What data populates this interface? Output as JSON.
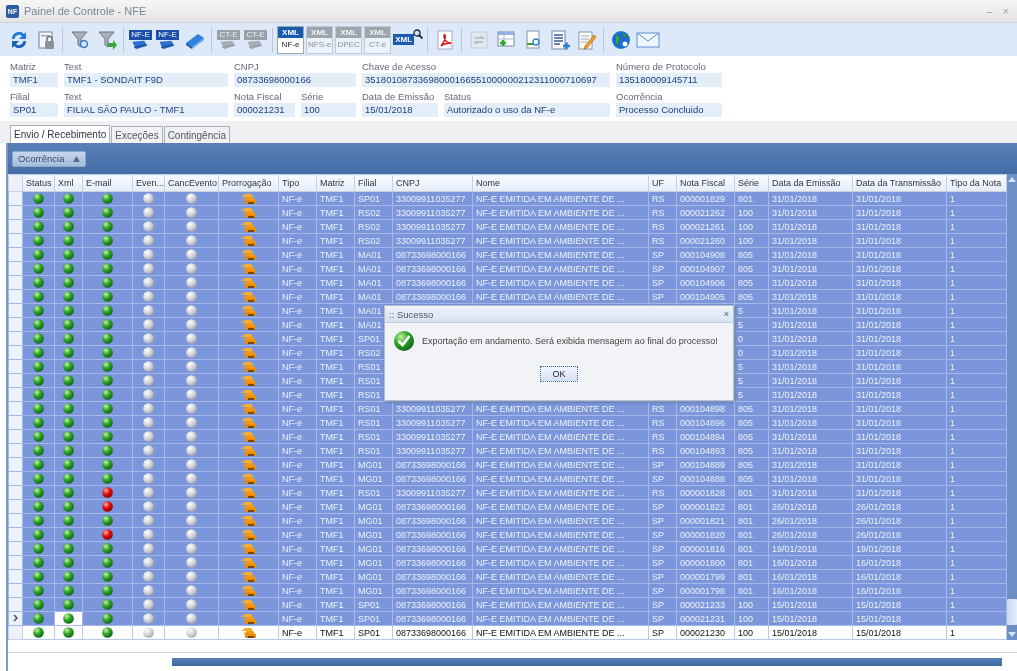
{
  "window": {
    "logo_text": "NF",
    "title": "Painel de Controle - NFE",
    "controls": [
      "–",
      "×"
    ]
  },
  "toolbar": [
    {
      "kind": "refresh",
      "disabled": false
    },
    {
      "kind": "lock-doc",
      "disabled": false
    },
    {
      "kind": "separator"
    },
    {
      "kind": "funnel-search",
      "disabled": false
    },
    {
      "kind": "funnel-arrow",
      "disabled": false
    },
    {
      "kind": "separator"
    },
    {
      "kind": "doc-badge",
      "label": "NF-E",
      "disabled": false
    },
    {
      "kind": "doc-badge",
      "label": "NF-E",
      "disabled": false
    },
    {
      "kind": "printer",
      "disabled": false
    },
    {
      "kind": "separator"
    },
    {
      "kind": "doc-badge",
      "label": "CT-E",
      "disabled": true
    },
    {
      "kind": "doc-badge",
      "label": "CT-E",
      "disabled": true
    },
    {
      "kind": "separator"
    },
    {
      "kind": "xml-tile",
      "label": "XML",
      "sublabel": "NF-e",
      "disabled": false
    },
    {
      "kind": "xml-tile",
      "label": "XML",
      "sublabel": "NFS-e",
      "disabled": true
    },
    {
      "kind": "xml-tile",
      "label": "XML",
      "sublabel": "DPEC",
      "disabled": true
    },
    {
      "kind": "xml-tile",
      "label": "XML",
      "sublabel": "CT-e",
      "disabled": true
    },
    {
      "kind": "xml-search",
      "label": "XML",
      "disabled": false
    },
    {
      "kind": "separator"
    },
    {
      "kind": "pdf",
      "disabled": false
    },
    {
      "kind": "separator"
    },
    {
      "kind": "sync",
      "disabled": true
    },
    {
      "kind": "table-add",
      "disabled": false
    },
    {
      "kind": "doc-search",
      "disabled": false
    },
    {
      "kind": "list-add",
      "disabled": false
    },
    {
      "kind": "edit",
      "disabled": false
    },
    {
      "kind": "separator"
    },
    {
      "kind": "globe",
      "disabled": false
    },
    {
      "kind": "mail",
      "disabled": false
    }
  ],
  "details": [
    [
      {
        "label": "Matriz",
        "value": "TMF1"
      },
      {
        "label": "Text",
        "value": "TMF1 - SONDAIT F9D"
      },
      {
        "label": "CNPJ",
        "value": "08733698000166"
      },
      {
        "label": "Chave de Acesso",
        "value": "35180108733698000166551000000212311000710697"
      },
      {
        "label": "Número de Protocolo",
        "value": "135180009145711"
      }
    ],
    [
      {
        "label": "Filial",
        "value": "SP01"
      },
      {
        "label": "Text",
        "value": "FILIAL SÃO PAULO - TMF1"
      },
      {
        "label": "Nota Fiscal",
        "value": "000021231"
      },
      {
        "label": "Série",
        "value": "100"
      },
      {
        "label": "Data de Emissão",
        "value": "15/01/2018"
      },
      {
        "label": "Status",
        "value": "Autorizado o uso da NF-e"
      },
      {
        "label": "Ocorrência",
        "value": "Processo Concluido"
      }
    ]
  ],
  "tabs": [
    {
      "label": "Envio / Recebimento",
      "selected": true
    },
    {
      "label": "Exceções",
      "selected": false
    },
    {
      "label": "Contingência",
      "selected": false
    }
  ],
  "group_by": {
    "label": "Ocorrência"
  },
  "table": {
    "columns": [
      "Status",
      "Xml",
      "E-mail",
      "Even...",
      "CancEvento",
      "Prorrogação",
      "Tipo",
      "Matriz",
      "Filial",
      "CNPJ",
      "Nome",
      "UF",
      "Nota Fiscal",
      "Série",
      "Data da Emissão",
      "Data da Transmissão",
      "Tipo da Nota"
    ],
    "rows": [
      {
        "email_ok": true,
        "tipo": "NF-e",
        "matriz": "TMF1",
        "filial": "SP01",
        "cnpj": "33009911035277",
        "nome": "NF-E EMITIDA EM AMBIENTE DE ...",
        "uf": "RS",
        "nota": "000001829",
        "serie": "801",
        "emissao": "31/01/2018",
        "transmissao": "31/01/2018",
        "tipo_nota": "1",
        "selected": true,
        "current": false
      },
      {
        "email_ok": true,
        "tipo": "NF-e",
        "matriz": "TMF1",
        "filial": "RS02",
        "cnpj": "33009911035277",
        "nome": "NF-E EMITIDA EM AMBIENTE DE ...",
        "uf": "RS",
        "nota": "000021262",
        "serie": "100",
        "emissao": "31/01/2018",
        "transmissao": "31/01/2018",
        "tipo_nota": "1",
        "selected": true,
        "current": false
      },
      {
        "email_ok": true,
        "tipo": "NF-e",
        "matriz": "TMF1",
        "filial": "RS02",
        "cnpj": "33009911035277",
        "nome": "NF-E EMITIDA EM AMBIENTE DE ...",
        "uf": "RS",
        "nota": "000021261",
        "serie": "100",
        "emissao": "31/01/2018",
        "transmissao": "31/01/2018",
        "tipo_nota": "1",
        "selected": true,
        "current": false
      },
      {
        "email_ok": true,
        "tipo": "NF-e",
        "matriz": "TMF1",
        "filial": "RS02",
        "cnpj": "33009911035277",
        "nome": "NF-E EMITIDA EM AMBIENTE DE ...",
        "uf": "RS",
        "nota": "000021260",
        "serie": "100",
        "emissao": "31/01/2018",
        "transmissao": "31/01/2018",
        "tipo_nota": "1",
        "selected": true,
        "current": false
      },
      {
        "email_ok": true,
        "tipo": "NF-e",
        "matriz": "TMF1",
        "filial": "MA01",
        "cnpj": "08733698000166",
        "nome": "NF-E EMITIDA EM AMBIENTE DE ...",
        "uf": "SP",
        "nota": "000104908",
        "serie": "805",
        "emissao": "31/01/2018",
        "transmissao": "31/01/2018",
        "tipo_nota": "1",
        "selected": true,
        "current": false
      },
      {
        "email_ok": true,
        "tipo": "NF-e",
        "matriz": "TMF1",
        "filial": "MA01",
        "cnpj": "08733698000166",
        "nome": "NF-E EMITIDA EM AMBIENTE DE ...",
        "uf": "SP",
        "nota": "000104907",
        "serie": "805",
        "emissao": "31/01/2018",
        "transmissao": "31/01/2018",
        "tipo_nota": "1",
        "selected": true,
        "current": false
      },
      {
        "email_ok": true,
        "tipo": "NF-e",
        "matriz": "TMF1",
        "filial": "MA01",
        "cnpj": "08733698000166",
        "nome": "NF-E EMITIDA EM AMBIENTE DE ...",
        "uf": "SP",
        "nota": "000104906",
        "serie": "805",
        "emissao": "31/01/2018",
        "transmissao": "31/01/2018",
        "tipo_nota": "1",
        "selected": true,
        "current": false
      },
      {
        "email_ok": true,
        "tipo": "NF-e",
        "matriz": "TMF1",
        "filial": "MA01",
        "cnpj": "08733698000166",
        "nome": "NF-E EMITIDA EM AMBIENTE DE ...",
        "uf": "SP",
        "nota": "000104905",
        "serie": "805",
        "emissao": "31/01/2018",
        "transmissao": "31/01/2018",
        "tipo_nota": "1",
        "selected": true,
        "current": false
      },
      {
        "email_ok": true,
        "tipo": "NF-e",
        "matriz": "TMF1",
        "filial": "MA01",
        "serie": "5",
        "emissao": "31/01/2018",
        "transmissao": "31/01/2018",
        "tipo_nota": "1",
        "selected": true,
        "current": false
      },
      {
        "email_ok": true,
        "tipo": "NF-e",
        "matriz": "TMF1",
        "filial": "MA01",
        "serie": "5",
        "emissao": "31/01/2018",
        "transmissao": "31/01/2018",
        "tipo_nota": "1",
        "selected": true,
        "current": false
      },
      {
        "email_ok": true,
        "tipo": "NF-e",
        "matriz": "TMF1",
        "filial": "SP01",
        "serie": "0",
        "emissao": "31/01/2018",
        "transmissao": "31/01/2018",
        "tipo_nota": "1",
        "selected": true,
        "current": false
      },
      {
        "email_ok": true,
        "tipo": "NF-e",
        "matriz": "TMF1",
        "filial": "RS02",
        "serie": "0",
        "emissao": "31/01/2018",
        "transmissao": "31/01/2018",
        "tipo_nota": "1",
        "selected": true,
        "current": false
      },
      {
        "email_ok": true,
        "tipo": "NF-e",
        "matriz": "TMF1",
        "filial": "RS01",
        "serie": "5",
        "emissao": "31/01/2018",
        "transmissao": "31/01/2018",
        "tipo_nota": "1",
        "selected": true,
        "current": false
      },
      {
        "email_ok": true,
        "tipo": "NF-e",
        "matriz": "TMF1",
        "filial": "RS01",
        "serie": "5",
        "emissao": "31/01/2018",
        "transmissao": "31/01/2018",
        "tipo_nota": "1",
        "selected": true,
        "current": false
      },
      {
        "email_ok": true,
        "tipo": "NF-e",
        "matriz": "TMF1",
        "filial": "RS01",
        "serie": "5",
        "emissao": "31/01/2018",
        "transmissao": "31/01/2018",
        "tipo_nota": "1",
        "selected": true,
        "current": false
      },
      {
        "email_ok": true,
        "tipo": "NF-e",
        "matriz": "TMF1",
        "filial": "RS01",
        "cnpj": "33009911035277",
        "nome": "NF-E EMITIDA EM AMBIENTE DE ...",
        "uf": "RS",
        "nota": "000104898",
        "serie": "805",
        "emissao": "31/01/2018",
        "transmissao": "31/01/2018",
        "tipo_nota": "1",
        "selected": true,
        "current": false
      },
      {
        "email_ok": true,
        "tipo": "NF-e",
        "matriz": "TMF1",
        "filial": "RS01",
        "cnpj": "33009911035277",
        "nome": "NF-E EMITIDA EM AMBIENTE DE ...",
        "uf": "RS",
        "nota": "000104896",
        "serie": "805",
        "emissao": "31/01/2018",
        "transmissao": "31/01/2018",
        "tipo_nota": "1",
        "selected": true,
        "current": false
      },
      {
        "email_ok": true,
        "tipo": "NF-e",
        "matriz": "TMF1",
        "filial": "RS01",
        "cnpj": "33009911035277",
        "nome": "NF-E EMITIDA EM AMBIENTE DE ...",
        "uf": "RS",
        "nota": "000104894",
        "serie": "805",
        "emissao": "31/01/2018",
        "transmissao": "31/01/2018",
        "tipo_nota": "1",
        "selected": true,
        "current": false
      },
      {
        "email_ok": true,
        "tipo": "NF-e",
        "matriz": "TMF1",
        "filial": "RS01",
        "cnpj": "33009911035277",
        "nome": "NF-E EMITIDA EM AMBIENTE DE ...",
        "uf": "RS",
        "nota": "000104893",
        "serie": "805",
        "emissao": "31/01/2018",
        "transmissao": "31/01/2018",
        "tipo_nota": "1",
        "selected": true,
        "current": false
      },
      {
        "email_ok": true,
        "tipo": "NF-e",
        "matriz": "TMF1",
        "filial": "MG01",
        "cnpj": "08733698000166",
        "nome": "NF-E EMITIDA EM AMBIENTE DE ...",
        "uf": "SP",
        "nota": "000104889",
        "serie": "805",
        "emissao": "31/01/2018",
        "transmissao": "31/01/2018",
        "tipo_nota": "1",
        "selected": true,
        "current": false
      },
      {
        "email_ok": true,
        "tipo": "NF-e",
        "matriz": "TMF1",
        "filial": "MG01",
        "cnpj": "08733698000166",
        "nome": "NF-E EMITIDA EM AMBIENTE DE ...",
        "uf": "SP",
        "nota": "000104888",
        "serie": "805",
        "emissao": "31/01/2018",
        "transmissao": "31/01/2018",
        "tipo_nota": "1",
        "selected": true,
        "current": false
      },
      {
        "email_ok": false,
        "tipo": "NF-e",
        "matriz": "TMF1",
        "filial": "RS01",
        "cnpj": "33009911035277",
        "nome": "NF-E EMITIDA EM AMBIENTE DE ...",
        "uf": "RS",
        "nota": "000001828",
        "serie": "801",
        "emissao": "31/01/2018",
        "transmissao": "31/01/2018",
        "tipo_nota": "1",
        "selected": true,
        "current": false
      },
      {
        "email_ok": false,
        "tipo": "NF-e",
        "matriz": "TMF1",
        "filial": "MG01",
        "cnpj": "08733698000166",
        "nome": "NF-E EMITIDA EM AMBIENTE DE ...",
        "uf": "SP",
        "nota": "000001822",
        "serie": "801",
        "emissao": "26/01/2018",
        "transmissao": "26/01/2018",
        "tipo_nota": "1",
        "selected": true,
        "current": false
      },
      {
        "email_ok": true,
        "tipo": "NF-e",
        "matriz": "TMF1",
        "filial": "MG01",
        "cnpj": "08733698000166",
        "nome": "NF-E EMITIDA EM AMBIENTE DE ...",
        "uf": "SP",
        "nota": "000001821",
        "serie": "801",
        "emissao": "26/01/2018",
        "transmissao": "26/01/2018",
        "tipo_nota": "1",
        "selected": true,
        "current": false
      },
      {
        "email_ok": false,
        "tipo": "NF-e",
        "matriz": "TMF1",
        "filial": "MG01",
        "cnpj": "08733698000166",
        "nome": "NF-E EMITIDA EM AMBIENTE DE ...",
        "uf": "SP",
        "nota": "000001820",
        "serie": "801",
        "emissao": "26/01/2018",
        "transmissao": "26/01/2018",
        "tipo_nota": "1",
        "selected": true,
        "current": false
      },
      {
        "email_ok": true,
        "tipo": "NF-e",
        "matriz": "TMF1",
        "filial": "MG01",
        "cnpj": "08733698000166",
        "nome": "NF-E EMITIDA EM AMBIENTE DE ...",
        "uf": "SP",
        "nota": "000001816",
        "serie": "801",
        "emissao": "19/01/2018",
        "transmissao": "19/01/2018",
        "tipo_nota": "1",
        "selected": true,
        "current": false
      },
      {
        "email_ok": true,
        "tipo": "NF-e",
        "matriz": "TMF1",
        "filial": "MG01",
        "cnpj": "08733698000166",
        "nome": "NF-E EMITIDA EM AMBIENTE DE ...",
        "uf": "SP",
        "nota": "000001800",
        "serie": "801",
        "emissao": "16/01/2018",
        "transmissao": "16/01/2018",
        "tipo_nota": "1",
        "selected": true,
        "current": false
      },
      {
        "email_ok": true,
        "tipo": "NF-e",
        "matriz": "TMF1",
        "filial": "MG01",
        "cnpj": "08733698000166",
        "nome": "NF-E EMITIDA EM AMBIENTE DE ...",
        "uf": "SP",
        "nota": "000001799",
        "serie": "801",
        "emissao": "16/01/2018",
        "transmissao": "16/01/2018",
        "tipo_nota": "1",
        "selected": true,
        "current": false
      },
      {
        "email_ok": true,
        "tipo": "NF-e",
        "matriz": "TMF1",
        "filial": "MG01",
        "cnpj": "08733698000166",
        "nome": "NF-E EMITIDA EM AMBIENTE DE ...",
        "uf": "SP",
        "nota": "000001798",
        "serie": "801",
        "emissao": "16/01/2018",
        "transmissao": "16/01/2018",
        "tipo_nota": "1",
        "selected": true,
        "current": false
      },
      {
        "email_ok": true,
        "tipo": "NF-e",
        "matriz": "TMF1",
        "filial": "SP01",
        "cnpj": "08733698000166",
        "nome": "NF-E EMITIDA EM AMBIENTE DE ...",
        "uf": "SP",
        "nota": "000021233",
        "serie": "100",
        "emissao": "15/01/2018",
        "transmissao": "15/01/2018",
        "tipo_nota": "1",
        "selected": true,
        "current": false
      },
      {
        "email_ok": true,
        "tipo": "NF-e",
        "matriz": "TMF1",
        "filial": "SP01",
        "cnpj": "08733698000166",
        "nome": "NF-E EMITIDA EM AMBIENTE DE ...",
        "uf": "SP",
        "nota": "000021231",
        "serie": "100",
        "emissao": "15/01/2018",
        "transmissao": "15/01/2018",
        "tipo_nota": "1",
        "selected": true,
        "current": true
      },
      {
        "email_ok": true,
        "tipo": "NF-e",
        "matriz": "TMF1",
        "filial": "SP01",
        "cnpj": "08733698000166",
        "nome": "NF-E EMITIDA EM AMBIENTE DE ...",
        "uf": "SP",
        "nota": "000021230",
        "serie": "100",
        "emissao": "15/01/2018",
        "transmissao": "15/01/2018",
        "tipo_nota": "1",
        "selected": false,
        "current": false
      }
    ]
  },
  "dialog": {
    "title": ":: Sucesso",
    "close": "×",
    "message": "Exportação em andamento. Será exibida mensagem ao final do processo!",
    "button": "OK"
  }
}
